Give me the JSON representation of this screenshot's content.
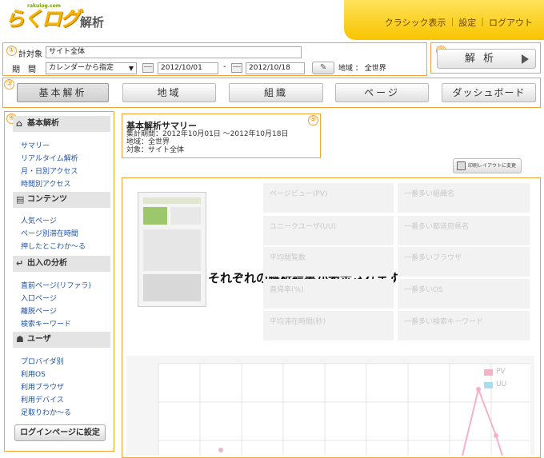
{
  "header": {
    "logo_text": "らくログ",
    "logo_suffix": "解析",
    "logo_domain": "rakulog.com",
    "nav": [
      "クラシック表示",
      "設定",
      "ログアウト"
    ]
  },
  "markers": [
    "①",
    "②",
    "③",
    "④",
    "⑤"
  ],
  "filter": {
    "target_label": "計対象",
    "target_value": "サイト全体",
    "period_label": "期　間",
    "period_mode": "カレンダーから指定",
    "date_from": "2012/10/01",
    "date_sep": "-",
    "date_to": "2012/10/18",
    "region_label": "地域 ： 全世界",
    "analyze_label": "解析"
  },
  "tabs": [
    "基本解析",
    "地域",
    "組織",
    "ページ",
    "ダッシュボード"
  ],
  "sidebar": {
    "sections": [
      {
        "title": "基本解析",
        "items": [
          "サマリー",
          "リアルタイム解析",
          "月・日別アクセス",
          "時間別アクセス"
        ]
      },
      {
        "title": "コンテンツ",
        "items": [
          "人気ページ",
          "ページ別滞在時間",
          "押したとこわか～る"
        ]
      },
      {
        "title": "出入の分析",
        "items": [
          "直前ページ(リファラ)",
          "入口ページ",
          "離脱ページ",
          "検索キーワード"
        ]
      },
      {
        "title": "ユーザ",
        "items": [
          "プロバイダ別",
          "利用OS",
          "利用ブラウザ",
          "利用デバイス",
          "足取りわか～る"
        ]
      }
    ],
    "login_button": "ログインページに設定"
  },
  "summary": {
    "title": "基本解析サマリー",
    "lines": [
      "集計期間：2012年10月01日 ～2012年10月18日",
      "地域：全世界",
      "対象：サイト全体"
    ],
    "print_button": "印刷レイアウトに変更"
  },
  "results": {
    "left_stats": [
      "ページビュー(PV)",
      "ユニークユーザ(UU)",
      "平均閲覧数",
      "直帰率(%)",
      "平均滞在時間(秒)"
    ],
    "right_stats": [
      "一番多い組織名",
      "一番多い都道府県名",
      "一番多いブラウザ",
      "一番多いOS",
      "一番多い検索キーワード"
    ],
    "overlay_message": "それぞれの解析結果が表示されます"
  },
  "chart_data": {
    "type": "line",
    "title": "",
    "series": [
      {
        "name": "PV"
      },
      {
        "name": "UU"
      }
    ],
    "colors": {
      "PV": "#f4b2c6",
      "UU": "#a9dcee"
    }
  },
  "colors": {
    "accent": "#f3a436",
    "link": "#2152a5",
    "header": "#f9c400"
  }
}
